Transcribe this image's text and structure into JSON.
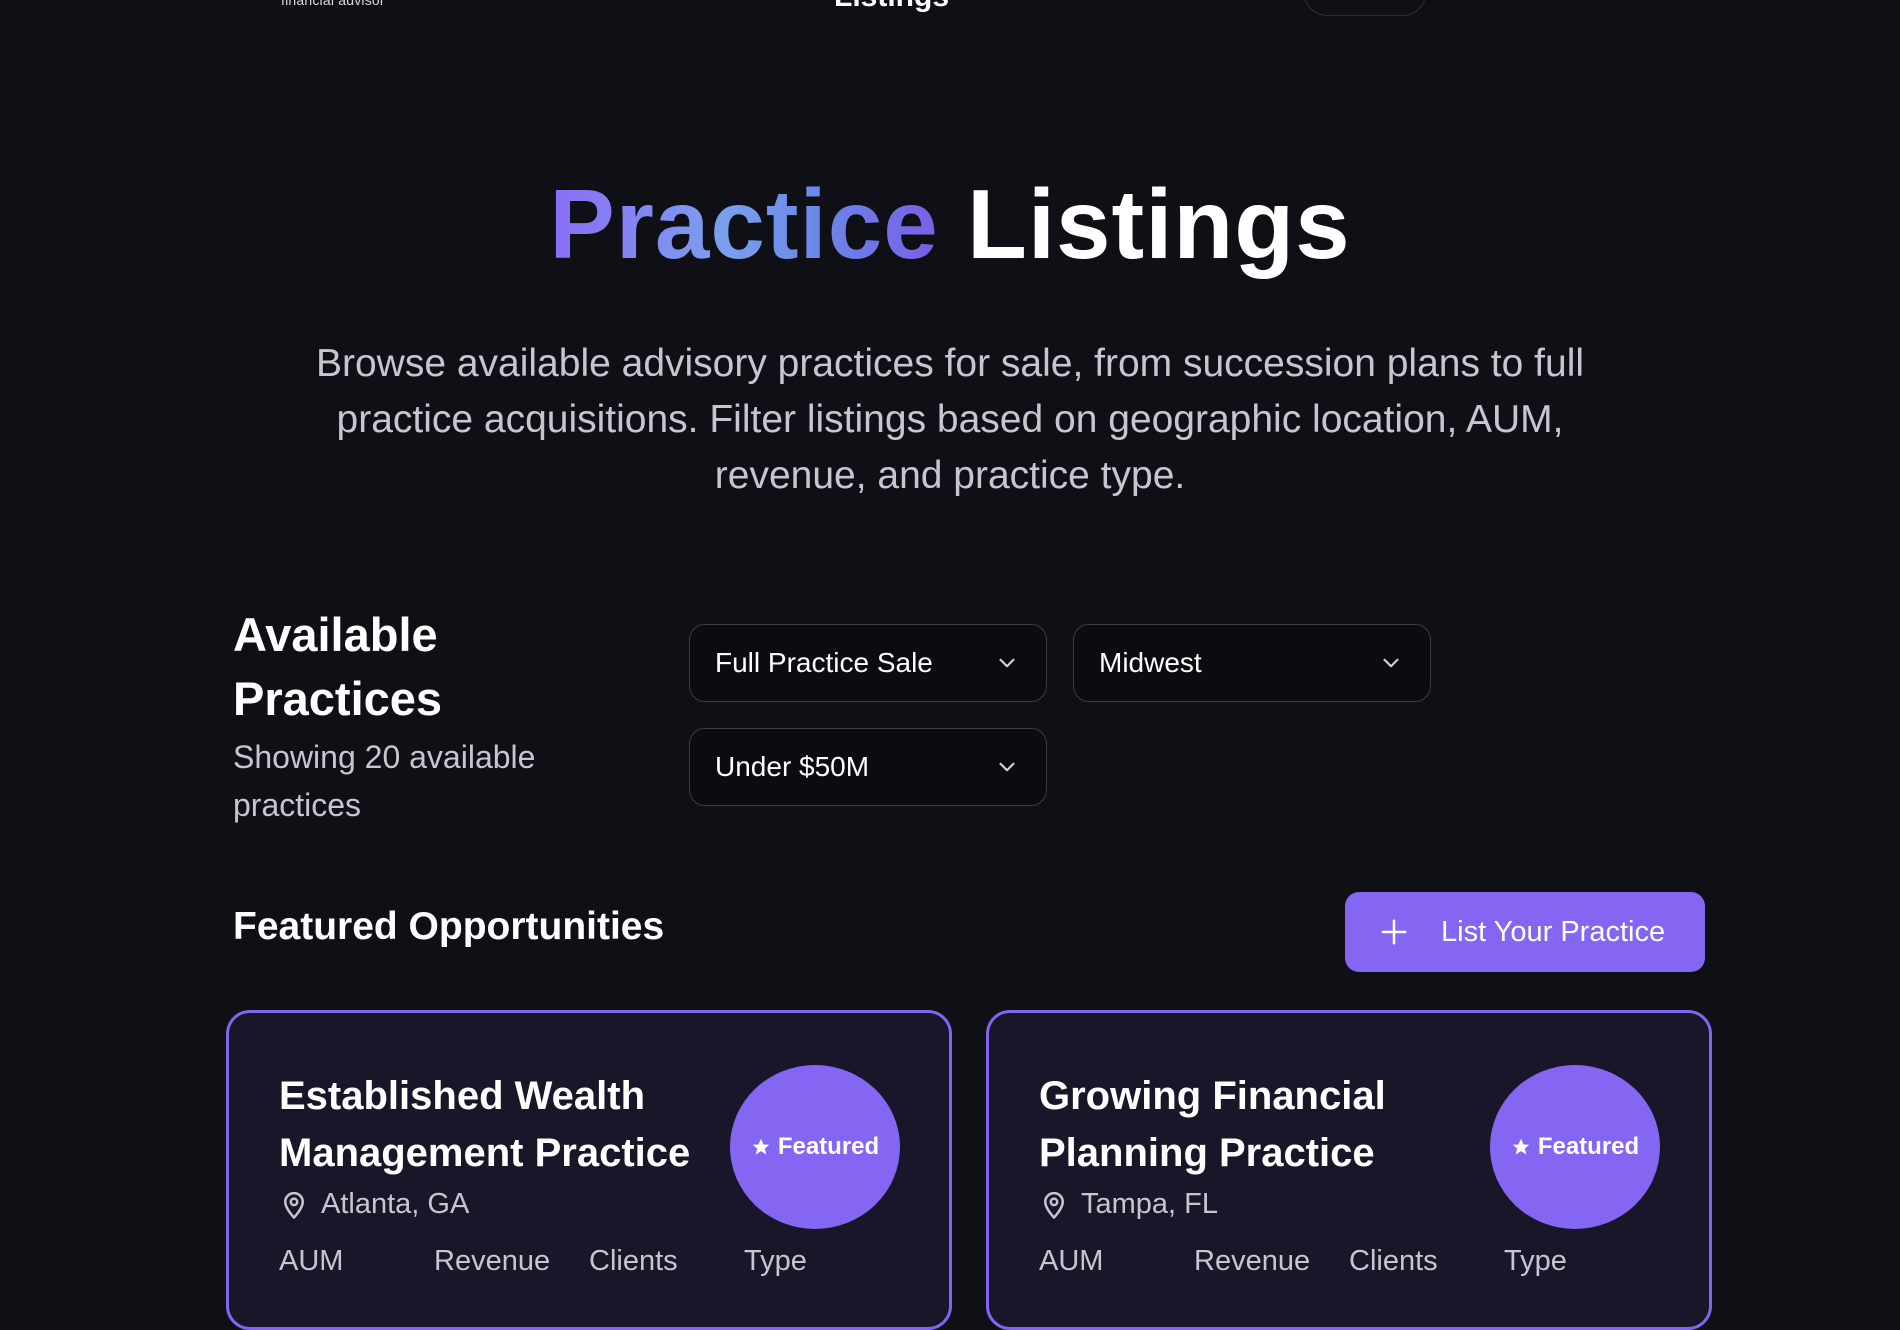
{
  "nav": {
    "logo_subtitle": "financial advisor",
    "center_label": "Listings"
  },
  "hero": {
    "title_accent": "Practice",
    "title_rest": "Listings",
    "subtitle": "Browse available advisory practices for sale, from succession plans to full practice acquisitions. Filter listings based on geographic location, AUM, revenue, and practice type."
  },
  "available": {
    "title": "Available Practices",
    "count_text": "Showing 20 available practices"
  },
  "filters": {
    "practice_type": "Full Practice Sale",
    "region": "Midwest",
    "aum": "Under $50M"
  },
  "featured": {
    "title": "Featured Opportunities",
    "list_button": "List Your Practice",
    "cards": [
      {
        "title": "Established Wealth Management Practice",
        "location": "Atlanta, GA",
        "badge": "Featured",
        "stat_labels": [
          "AUM",
          "Revenue",
          "Clients",
          "Type"
        ]
      },
      {
        "title": "Growing Financial Planning Practice",
        "location": "Tampa, FL",
        "badge": "Featured",
        "stat_labels": [
          "AUM",
          "Revenue",
          "Clients",
          "Type"
        ]
      }
    ]
  },
  "colors": {
    "background": "#0f1016",
    "accent": "#8566f2",
    "card_bg": "#181628"
  }
}
